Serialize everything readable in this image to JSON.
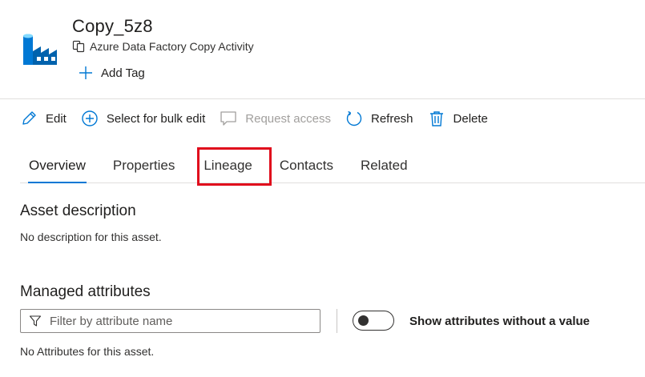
{
  "asset": {
    "title": "Copy_5z8",
    "type_label": "Azure Data Factory Copy Activity",
    "add_tag_label": "Add Tag",
    "icon": "factory-icon",
    "brand_color": "#0078d4"
  },
  "toolbar": {
    "edit": "Edit",
    "bulk_edit": "Select for bulk edit",
    "request_access": "Request access",
    "refresh": "Refresh",
    "delete": "Delete"
  },
  "tabs": [
    {
      "label": "Overview",
      "active": true
    },
    {
      "label": "Properties",
      "active": false
    },
    {
      "label": "Lineage",
      "active": false,
      "highlighted": true
    },
    {
      "label": "Contacts",
      "active": false
    },
    {
      "label": "Related",
      "active": false
    }
  ],
  "highlight_color": "#e00b1c",
  "description": {
    "heading": "Asset description",
    "text": "No description for this asset."
  },
  "managed_attributes": {
    "heading": "Managed attributes",
    "filter_placeholder": "Filter by attribute name",
    "filter_value": "",
    "toggle_label": "Show attributes without a value",
    "toggle_on": false,
    "empty_text": "No Attributes for this asset."
  }
}
